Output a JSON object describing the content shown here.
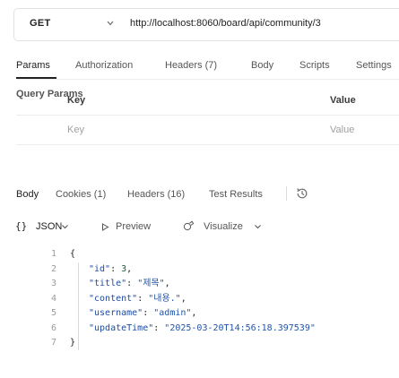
{
  "request": {
    "method": "GET",
    "url": "http://localhost:8060/board/api/community/3"
  },
  "request_tabs": [
    {
      "label": "Params",
      "active": true
    },
    {
      "label": "Authorization",
      "active": false
    },
    {
      "label": "Headers (7)",
      "active": false
    },
    {
      "label": "Body",
      "active": false
    },
    {
      "label": "Scripts",
      "active": false
    },
    {
      "label": "Settings",
      "active": false
    }
  ],
  "query_params": {
    "title": "Query Params",
    "headers": {
      "key": "Key",
      "value": "Value"
    },
    "placeholders": {
      "key": "Key",
      "value": "Value"
    }
  },
  "response_tabs": [
    {
      "label": "Body",
      "active": true
    },
    {
      "label": "Cookies (1)",
      "active": false
    },
    {
      "label": "Headers (16)",
      "active": false
    },
    {
      "label": "Test Results",
      "active": false
    }
  ],
  "response_format": {
    "braces": "{}",
    "format_label": "JSON",
    "preview_label": "Preview",
    "visualize_label": "Visualize"
  },
  "response_body": {
    "line_numbers": [
      "1",
      "2",
      "3",
      "4",
      "5",
      "6",
      "7"
    ],
    "open_brace": "{",
    "close_brace": "}",
    "fields": [
      {
        "key": "\"id\"",
        "value": "3",
        "kind": "num",
        "comma": ","
      },
      {
        "key": "\"title\"",
        "value": "\"제목\"",
        "kind": "str",
        "comma": ","
      },
      {
        "key": "\"content\"",
        "value": "\"내용.\"",
        "kind": "str",
        "comma": ","
      },
      {
        "key": "\"username\"",
        "value": "\"admin\"",
        "kind": "str",
        "comma": ","
      },
      {
        "key": "\"updateTime\"",
        "value": "\"2025-03-20T14:56:18.397539\"",
        "kind": "str",
        "comma": ""
      }
    ]
  },
  "colors": {
    "accent_underline": "#212121",
    "json_key": "#1d4ba4",
    "json_string": "#2255a8",
    "json_number": "#16653d"
  }
}
